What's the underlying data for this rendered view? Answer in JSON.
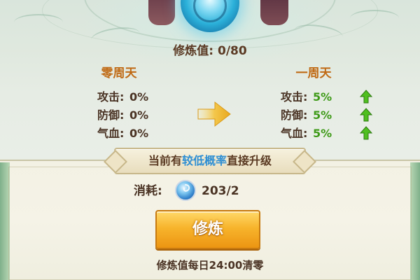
{
  "header": {
    "cultivation_label": "修炼值",
    "cultivation_value": "0/80"
  },
  "current_level": {
    "title": "零周天",
    "stats": [
      {
        "label": "攻击:",
        "value": "0%"
      },
      {
        "label": "防御:",
        "value": "0%"
      },
      {
        "label": "气血:",
        "value": "0%"
      }
    ]
  },
  "next_level": {
    "title": "一周天",
    "stats": [
      {
        "label": "攻击:",
        "value": "5%"
      },
      {
        "label": "防御:",
        "value": "5%"
      },
      {
        "label": "气血:",
        "value": "5%"
      }
    ]
  },
  "banner": {
    "prefix": "当前有",
    "highlight": "较低概率",
    "suffix": "直接升级"
  },
  "cost": {
    "label": "消耗:",
    "icon": "blue-orb-item-icon",
    "amount": "203/2"
  },
  "action": {
    "button_label": "修炼"
  },
  "footer": {
    "reset_note": "修炼值每日24:00清零"
  },
  "colors": {
    "title_orange": "#c06a14",
    "increase_green": "#3e9a18",
    "highlight_blue": "#2f8fd3",
    "button_gold": "#f7b42c"
  }
}
